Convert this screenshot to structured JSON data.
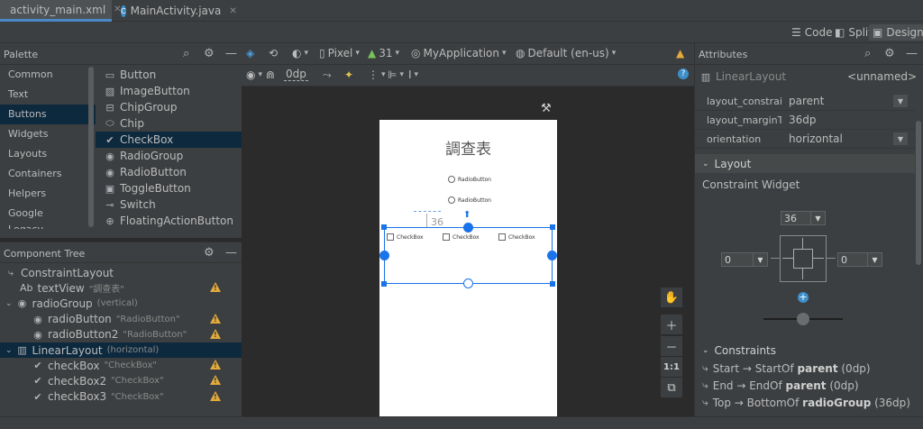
{
  "tabs": [
    {
      "label": "activity_main.xml",
      "active": true
    },
    {
      "label": "MainActivity.java",
      "active": false
    }
  ],
  "view_modes": {
    "code": "Code",
    "split": "Split",
    "design": "Design"
  },
  "palette": {
    "title": "Palette",
    "categories": [
      "Common",
      "Text",
      "Buttons",
      "Widgets",
      "Layouts",
      "Containers",
      "Helpers",
      "Google",
      "Legacy"
    ],
    "selected_category": "Buttons",
    "items": [
      "Button",
      "ImageButton",
      "ChipGroup",
      "Chip",
      "CheckBox",
      "RadioGroup",
      "RadioButton",
      "ToggleButton",
      "Switch",
      "FloatingActionButton"
    ],
    "selected_item": "CheckBox"
  },
  "component_tree": {
    "title": "Component Tree",
    "rows": [
      {
        "label": "ConstraintLayout",
        "hint": ""
      },
      {
        "label": "textView",
        "hint": "\"調查表\"",
        "prefix": "Ab"
      },
      {
        "label": "radioGroup",
        "hint": "(vertical)"
      },
      {
        "label": "radioButton",
        "hint": "\"RadioButton\""
      },
      {
        "label": "radioButton2",
        "hint": "\"RadioButton\""
      },
      {
        "label": "LinearLayout",
        "hint": "(horizontal)"
      },
      {
        "label": "checkBox",
        "hint": "\"CheckBox\""
      },
      {
        "label": "checkBox2",
        "hint": "\"CheckBox\""
      },
      {
        "label": "checkBox3",
        "hint": "\"CheckBox\""
      }
    ]
  },
  "design_toolbar": {
    "device": "Pixel",
    "api": "31",
    "app": "MyApplication",
    "locale": "Default (en-us)",
    "margin": "0dp"
  },
  "preview": {
    "title": "調查表",
    "radio_1": "RadioButton",
    "radio_2": "RadioButton",
    "checkboxes": [
      "CheckBox",
      "CheckBox",
      "CheckBox"
    ],
    "margin_label": "36"
  },
  "canvas_tools": {
    "one_to_one": "1:1"
  },
  "attributes": {
    "title": "Attributes",
    "widget": "LinearLayout",
    "id": "<unnamed>",
    "rows": [
      {
        "key": "layout_constraint...",
        "value": "parent"
      },
      {
        "key": "layout_marginTop",
        "value": "36dp"
      },
      {
        "key": "orientation",
        "value": "horizontal"
      }
    ],
    "layout_section": "Layout",
    "constraint_widget": "Constraint Widget",
    "top_margin": "36",
    "left_margin": "0",
    "right_margin": "0",
    "constraints_section": "Constraints",
    "constraints": [
      {
        "text": "Start → StartOf ",
        "target": "parent",
        "value": " (0dp)"
      },
      {
        "text": "End → EndOf ",
        "target": "parent",
        "value": " (0dp)"
      },
      {
        "text": "Top → BottomOf ",
        "target": "radioGroup",
        "value": " (36dp)"
      }
    ]
  },
  "colors": {
    "accent": "#1a73e8",
    "warning": "#e2a93b",
    "selection": "#0d293e"
  }
}
